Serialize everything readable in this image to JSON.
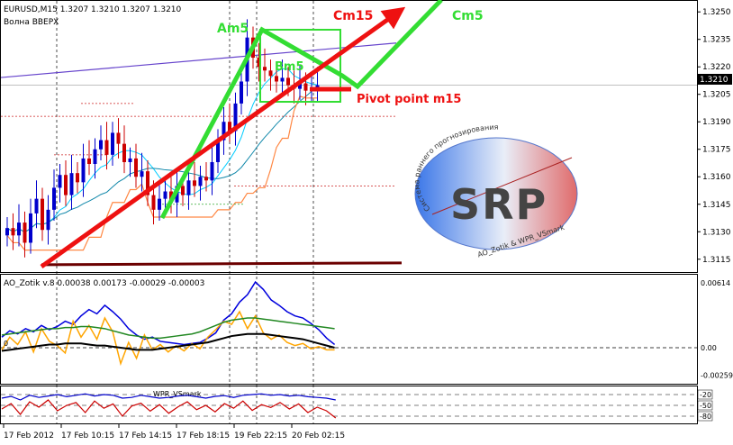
{
  "header": {
    "symbol_line": "EURUSD,M15  1.3207 1.3210 1.3207 1.3210",
    "subtitle": "Волна ВВЕРХ",
    "ao_line": "AO_Zotik v.8 0.00038 0.00173 -0.00029 -0.00003",
    "wpr_line": "WPR_VSmark"
  },
  "annotations": {
    "am5": "Am5",
    "bm5": "Bm5",
    "cm15": "Cm15",
    "cm5": "Cm5",
    "pivot": "Pivot point m15"
  },
  "logo": {
    "letters": "SRP",
    "arc_text": "Система раннего прогнозирования",
    "bottom_text": "AO_Zotik & WPR_VSmark"
  },
  "colors": {
    "bull": "#0000cc",
    "bear": "#cc0000",
    "ma_fast": "#00ccff",
    "ma_slow": "#ff8844",
    "level": "#6644cc",
    "wave": "#33dd33",
    "arrow": "#ee1111",
    "ao_blue": "#0000dd",
    "ao_orange": "#ffa500",
    "ao_green": "#228822",
    "ao_black": "#000000"
  },
  "chart_data": [
    {
      "type": "candlestick",
      "name": "EURUSD,M15",
      "ylim": [
        1.3108,
        1.3256
      ],
      "y_ticks": [
        "1.3250",
        "1.3235",
        "1.3220",
        "1.3205",
        "1.3190",
        "1.3175",
        "1.3160",
        "1.3145",
        "1.3130",
        "1.3115"
      ],
      "current_price": "1.3210",
      "x_ticks": [
        "17 Feb 2012",
        "17 Feb 10:15",
        "17 Feb 14:15",
        "17 Feb 18:15",
        "19 Feb 22:15",
        "20 Feb 02:15"
      ],
      "close_series": [
        1.3132,
        1.3128,
        1.3135,
        1.3124,
        1.314,
        1.3148,
        1.3131,
        1.3142,
        1.3154,
        1.3161,
        1.315,
        1.3162,
        1.3157,
        1.317,
        1.3167,
        1.3175,
        1.318,
        1.3172,
        1.3184,
        1.3178,
        1.3168,
        1.317,
        1.316,
        1.3163,
        1.315,
        1.3142,
        1.3148,
        1.3152,
        1.3146,
        1.3155,
        1.315,
        1.3158,
        1.3155,
        1.316,
        1.3158,
        1.3168,
        1.318,
        1.319,
        1.3185,
        1.32,
        1.3212,
        1.3236,
        1.3225,
        1.322,
        1.3218,
        1.3215,
        1.3212,
        1.3214,
        1.321,
        1.3208,
        1.3211,
        1.3207,
        1.3209,
        1.321
      ]
    },
    {
      "type": "line",
      "name": "AO_Zotik v.8",
      "y_ticks": [
        "0.00614",
        "0.00",
        "-0.00259"
      ],
      "series": [
        {
          "name": "blue",
          "values": [
            0.001,
            0.0016,
            0.0013,
            0.0018,
            0.0015,
            0.0021,
            0.0017,
            0.002,
            0.0025,
            0.0022,
            0.003,
            0.0036,
            0.0032,
            0.004,
            0.0034,
            0.0027,
            0.0018,
            0.0012,
            0.0008,
            0.001,
            0.0006,
            0.0005,
            0.0004,
            0.0003,
            0.0004,
            0.0005,
            0.0009,
            0.0014,
            0.0026,
            0.0032,
            0.0043,
            0.005,
            0.0062,
            0.0055,
            0.0045,
            0.004,
            0.0034,
            0.003,
            0.0028,
            0.0023,
            0.0017,
            0.0009,
            0.0003
          ]
        },
        {
          "name": "orange",
          "values": [
            -0.0002,
            0.001,
            0.0003,
            0.0015,
            -0.0004,
            0.0018,
            0.0006,
            0.0002,
            -0.0005,
            0.0025,
            0.001,
            0.0021,
            0.0008,
            0.0028,
            0.0015,
            -0.0015,
            0.0005,
            -0.001,
            0.0012,
            -0.0002,
            0.0003,
            -0.0004,
            0.0002,
            -0.0003,
            0.0004,
            -0.0001,
            0.001,
            0.0017,
            0.0025,
            0.0022,
            0.0034,
            0.0018,
            0.003,
            0.0014,
            0.0008,
            0.0012,
            0.0005,
            0.0002,
            0.0004,
            -0.0001,
            0.0001,
            -0.0002,
            -0.0002
          ]
        },
        {
          "name": "green",
          "values": [
            0.0012,
            0.0013,
            0.0014,
            0.0015,
            0.0016,
            0.0017,
            0.0018,
            0.0018,
            0.0019,
            0.0019,
            0.002,
            0.002,
            0.0019,
            0.0018,
            0.0016,
            0.0014,
            0.0012,
            0.0011,
            0.001,
            0.0009,
            0.0009,
            0.001,
            0.0011,
            0.0012,
            0.0013,
            0.0015,
            0.0018,
            0.0021,
            0.0024,
            0.0026,
            0.0027,
            0.0028,
            0.0028,
            0.0027,
            0.0026,
            0.0025,
            0.0024,
            0.0023,
            0.0022,
            0.0021,
            0.002,
            0.0019,
            0.0018
          ]
        },
        {
          "name": "black",
          "values": [
            -0.0003,
            -0.0002,
            -0.0001,
            0.0,
            0.0001,
            0.0002,
            0.0003,
            0.0003,
            0.0004,
            0.0004,
            0.0004,
            0.0003,
            0.0002,
            0.0002,
            0.0001,
            0.0,
            -0.0001,
            -0.0002,
            -0.0002,
            -0.0002,
            -0.0001,
            0.0,
            0.0001,
            0.0002,
            0.0003,
            0.0004,
            0.0005,
            0.0007,
            0.0009,
            0.0011,
            0.0012,
            0.0013,
            0.0013,
            0.0013,
            0.0012,
            0.0011,
            0.001,
            0.0009,
            0.0008,
            0.0006,
            0.0004,
            0.0002,
            0.0
          ]
        }
      ]
    },
    {
      "type": "line",
      "name": "WPR_VSmark",
      "y_ticks": [
        "-20",
        "-50",
        "-80"
      ],
      "series": [
        {
          "name": "blue",
          "values": [
            -30,
            -25,
            -35,
            -22,
            -28,
            -24,
            -20,
            -26,
            -22,
            -18,
            -24,
            -20,
            -22,
            -30,
            -28,
            -22,
            -26,
            -30,
            -28,
            -24,
            -22,
            -26,
            -30,
            -25,
            -23,
            -28,
            -22,
            -20,
            -18,
            -22,
            -20,
            -24,
            -22,
            -26,
            -28,
            -30,
            -35
          ]
        },
        {
          "name": "red",
          "values": [
            -60,
            -45,
            -75,
            -40,
            -55,
            -35,
            -65,
            -50,
            -42,
            -70,
            -38,
            -58,
            -46,
            -80,
            -52,
            -44,
            -66,
            -48,
            -72,
            -54,
            -40,
            -62,
            -50,
            -68,
            -45,
            -58,
            -38,
            -64,
            -48,
            -56,
            -42,
            -60,
            -46,
            -70,
            -55,
            -65,
            -85
          ]
        }
      ]
    }
  ]
}
